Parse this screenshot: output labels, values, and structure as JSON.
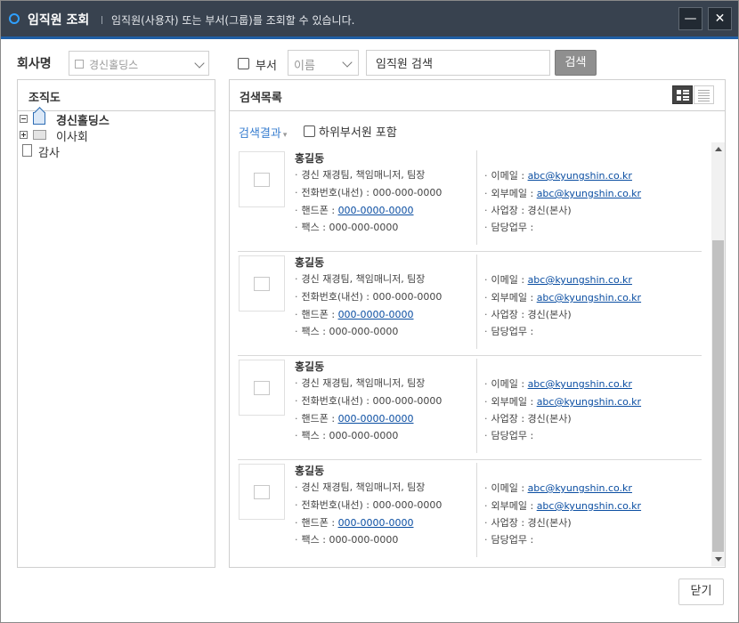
{
  "window": {
    "title": "임직원 조회",
    "description": "임직원(사용자) 또는 부서(그룹)를 조회할 수 있습니다.",
    "minimize_label": "—",
    "close_label": "✕",
    "accent_color": "#1f5fa6"
  },
  "toolbar": {
    "company_label": "회사명",
    "company_value": "경신홀딩스",
    "dept_label": "부서",
    "type_value": "이름",
    "search_value": "임직원 검색",
    "search_button": "검색"
  },
  "org": {
    "title": "조직도",
    "nodes": [
      {
        "label": "경신홀딩스",
        "icon": "home-icon",
        "expander": "minus"
      },
      {
        "label": "이사회",
        "icon": "folder-icon",
        "expander": "plus"
      },
      {
        "label": "감사",
        "icon": "document-icon",
        "expander": "none"
      }
    ]
  },
  "results": {
    "title": "검색목록",
    "result_label": "검색결과",
    "include_sub_label": "하위부서원 포함",
    "cards": [
      {
        "name": "홍길동",
        "position": "경신 재경팀, 책임매니저, 팀장",
        "office_phone": "전화번호(내선) : 000-000-0000",
        "mobile_prefix": "핸드폰 : ",
        "mobile": "000-0000-0000",
        "fax": "팩스 : 000-000-0000",
        "email_prefix": "이메일 : ",
        "email": "abc@kyungshin.co.kr",
        "ext_email_prefix": "외부메일 : ",
        "ext_email": "abc@kyungshin.co.kr",
        "site": "사업장 : 경신(본사)",
        "duty": "담당업무 :"
      },
      {
        "name": "홍길동",
        "position": "경신 재경팀, 책임매니저, 팀장",
        "office_phone": "전화번호(내선) : 000-000-0000",
        "mobile_prefix": "핸드폰 : ",
        "mobile": "000-0000-0000",
        "fax": "팩스 : 000-000-0000",
        "email_prefix": "이메일 : ",
        "email": "abc@kyungshin.co.kr",
        "ext_email_prefix": "외부메일 : ",
        "ext_email": "abc@kyungshin.co.kr",
        "site": "사업장 : 경신(본사)",
        "duty": "담당업무 :"
      },
      {
        "name": "홍길동",
        "position": "경신 재경팀, 책임매니저, 팀장",
        "office_phone": "전화번호(내선) : 000-000-0000",
        "mobile_prefix": "핸드폰 : ",
        "mobile": "000-0000-0000",
        "fax": "팩스 : 000-000-0000",
        "email_prefix": "이메일 : ",
        "email": "abc@kyungshin.co.kr",
        "ext_email_prefix": "외부메일 : ",
        "ext_email": "abc@kyungshin.co.kr",
        "site": "사업장 : 경신(본사)",
        "duty": "담당업무 :"
      },
      {
        "name": "홍길동",
        "position": "경신 재경팀, 책임매니저, 팀장",
        "office_phone": "전화번호(내선) : 000-000-0000",
        "mobile_prefix": "핸드폰 : ",
        "mobile": "000-0000-0000",
        "fax": "팩스 : 000-000-0000",
        "email_prefix": "이메일 : ",
        "email": "abc@kyungshin.co.kr",
        "ext_email_prefix": "외부메일 : ",
        "ext_email": "abc@kyungshin.co.kr",
        "site": "사업장 : 경신(본사)",
        "duty": "담당업무 :"
      }
    ]
  },
  "footer": {
    "close_button": "닫기"
  }
}
